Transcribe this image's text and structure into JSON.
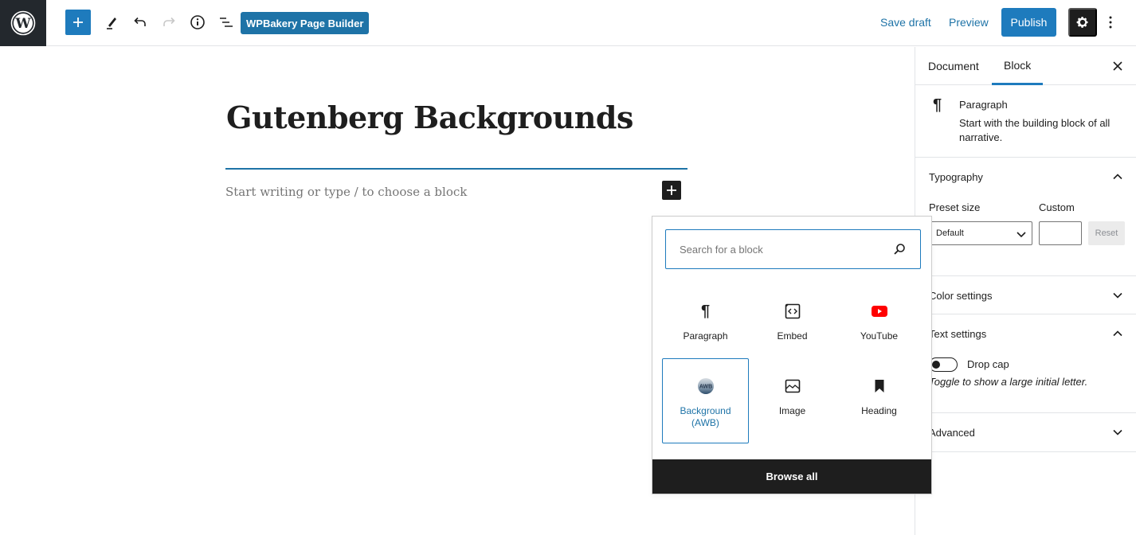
{
  "header": {
    "logo": "wordpress-logo",
    "toolbar": {
      "add_block": "plus-icon",
      "tools": "pencil-icon",
      "undo": "undo-icon",
      "redo": "redo-icon",
      "info": "info-icon",
      "outline": "list-outline-icon",
      "wpbakery_label": "WPBakery Page Builder"
    },
    "actions": {
      "save_draft": "Save draft",
      "preview": "Preview",
      "publish": "Publish",
      "settings": "gear-icon",
      "more": "vertical-ellipsis-icon"
    },
    "colors": {
      "accent": "#1e7bbd",
      "dark": "#1e1e1e",
      "logo_bg": "#23282d"
    }
  },
  "editor": {
    "title": "Gutenberg Backgrounds",
    "paragraph_placeholder": "Start writing or type / to choose a block"
  },
  "inserter": {
    "search_placeholder": "Search for a block",
    "search_value": "",
    "blocks": [
      {
        "label": "Paragraph",
        "icon": "paragraph-icon",
        "selected": false
      },
      {
        "label": "Embed",
        "icon": "embed-icon",
        "selected": false
      },
      {
        "label": "YouTube",
        "icon": "youtube-icon",
        "selected": false
      },
      {
        "label": "Background (AWB)",
        "icon": "awb-logo-icon",
        "selected": true
      },
      {
        "label": "Image",
        "icon": "image-icon",
        "selected": false
      },
      {
        "label": "Heading",
        "icon": "bookmark-icon",
        "selected": false
      }
    ],
    "browse_all": "Browse all",
    "youtube_color": "#ff0000"
  },
  "sidebar": {
    "tabs": [
      {
        "label": "Document",
        "active": false
      },
      {
        "label": "Block",
        "active": true
      }
    ],
    "block_card": {
      "icon": "¶",
      "title": "Paragraph",
      "description": "Start with the building block of all narrative."
    },
    "typography": {
      "title": "Typography",
      "expanded": true,
      "preset_label": "Preset size",
      "preset_value": "Default",
      "custom_label": "Custom",
      "custom_value": "",
      "reset_label": "Reset"
    },
    "color_settings": {
      "title": "Color settings",
      "expanded": false
    },
    "text_settings": {
      "title": "Text settings",
      "expanded": true,
      "drop_cap_label": "Drop cap",
      "drop_cap_on": false,
      "drop_cap_help": "Toggle to show a large initial letter."
    },
    "advanced": {
      "title": "Advanced",
      "expanded": false
    }
  }
}
